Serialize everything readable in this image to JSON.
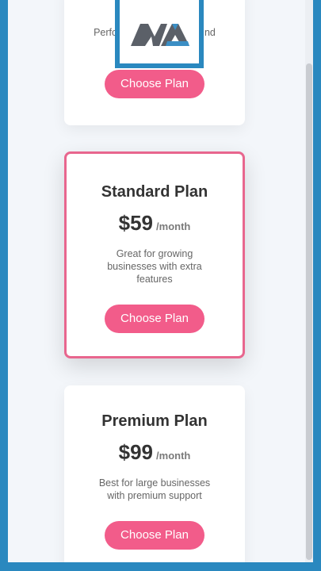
{
  "cards": {
    "basic": {
      "description_fragment_left": "Perfo",
      "description_fragment_right": "nd",
      "button": "Choose Plan"
    },
    "standard": {
      "name": "Standard Plan",
      "price": "$59",
      "period": "/month",
      "description": "Great for growing businesses with extra features",
      "button": "Choose Plan"
    },
    "premium": {
      "name": "Premium Plan",
      "price": "$99",
      "period": "/month",
      "description": "Best for large businesses with premium support",
      "button": "Choose Plan"
    }
  },
  "logo": {
    "text": "MA"
  },
  "colors": {
    "frame": "#2a88bf",
    "accent": "#f25c8a",
    "featured_border": "#e8668e",
    "page_bg": "#f3f6fa"
  }
}
